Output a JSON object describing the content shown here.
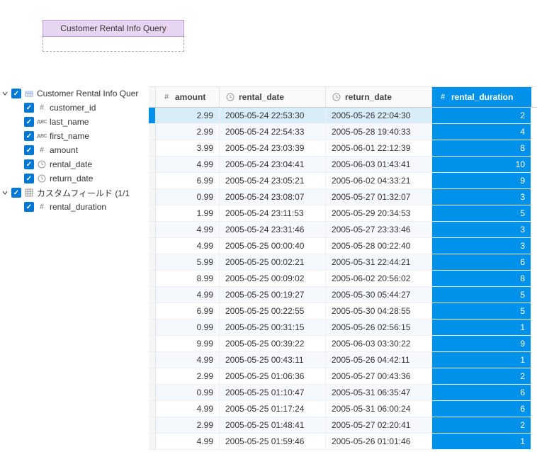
{
  "node": {
    "title": "Customer Rental Info Query"
  },
  "tree": {
    "root": {
      "label": "Customer Rental Info Quer"
    },
    "fields": [
      {
        "type": "num",
        "label": "customer_id"
      },
      {
        "type": "text",
        "label": "last_name"
      },
      {
        "type": "text",
        "label": "first_name"
      },
      {
        "type": "num",
        "label": "amount"
      },
      {
        "type": "date",
        "label": "rental_date"
      },
      {
        "type": "date",
        "label": "return_date"
      }
    ],
    "custom": {
      "label": "カスタムフィールド (1/1"
    },
    "custom_fields": [
      {
        "type": "num",
        "label": "rental_duration"
      }
    ]
  },
  "columns": {
    "amount": "amount",
    "rental_date": "rental_date",
    "return_date": "return_date",
    "rental_duration": "rental_duration"
  },
  "rows": [
    {
      "amount": "2.99",
      "rental_date": "2005-05-24 22:53:30",
      "return_date": "2005-05-26 22:04:30",
      "rental_duration": "2"
    },
    {
      "amount": "2.99",
      "rental_date": "2005-05-24 22:54:33",
      "return_date": "2005-05-28 19:40:33",
      "rental_duration": "4"
    },
    {
      "amount": "3.99",
      "rental_date": "2005-05-24 23:03:39",
      "return_date": "2005-06-01 22:12:39",
      "rental_duration": "8"
    },
    {
      "amount": "4.99",
      "rental_date": "2005-05-24 23:04:41",
      "return_date": "2005-06-03 01:43:41",
      "rental_duration": "10"
    },
    {
      "amount": "6.99",
      "rental_date": "2005-05-24 23:05:21",
      "return_date": "2005-06-02 04:33:21",
      "rental_duration": "9"
    },
    {
      "amount": "0.99",
      "rental_date": "2005-05-24 23:08:07",
      "return_date": "2005-05-27 01:32:07",
      "rental_duration": "3"
    },
    {
      "amount": "1.99",
      "rental_date": "2005-05-24 23:11:53",
      "return_date": "2005-05-29 20:34:53",
      "rental_duration": "5"
    },
    {
      "amount": "4.99",
      "rental_date": "2005-05-24 23:31:46",
      "return_date": "2005-05-27 23:33:46",
      "rental_duration": "3"
    },
    {
      "amount": "4.99",
      "rental_date": "2005-05-25 00:00:40",
      "return_date": "2005-05-28 00:22:40",
      "rental_duration": "3"
    },
    {
      "amount": "5.99",
      "rental_date": "2005-05-25 00:02:21",
      "return_date": "2005-05-31 22:44:21",
      "rental_duration": "6"
    },
    {
      "amount": "8.99",
      "rental_date": "2005-05-25 00:09:02",
      "return_date": "2005-06-02 20:56:02",
      "rental_duration": "8"
    },
    {
      "amount": "4.99",
      "rental_date": "2005-05-25 00:19:27",
      "return_date": "2005-05-30 05:44:27",
      "rental_duration": "5"
    },
    {
      "amount": "6.99",
      "rental_date": "2005-05-25 00:22:55",
      "return_date": "2005-05-30 04:28:55",
      "rental_duration": "5"
    },
    {
      "amount": "0.99",
      "rental_date": "2005-05-25 00:31:15",
      "return_date": "2005-05-26 02:56:15",
      "rental_duration": "1"
    },
    {
      "amount": "9.99",
      "rental_date": "2005-05-25 00:39:22",
      "return_date": "2005-06-03 03:30:22",
      "rental_duration": "9"
    },
    {
      "amount": "4.99",
      "rental_date": "2005-05-25 00:43:11",
      "return_date": "2005-05-26 04:42:11",
      "rental_duration": "1"
    },
    {
      "amount": "2.99",
      "rental_date": "2005-05-25 01:06:36",
      "return_date": "2005-05-27 00:43:36",
      "rental_duration": "2"
    },
    {
      "amount": "0.99",
      "rental_date": "2005-05-25 01:10:47",
      "return_date": "2005-05-31 06:35:47",
      "rental_duration": "6"
    },
    {
      "amount": "4.99",
      "rental_date": "2005-05-25 01:17:24",
      "return_date": "2005-05-31 06:00:24",
      "rental_duration": "6"
    },
    {
      "amount": "2.99",
      "rental_date": "2005-05-25 01:48:41",
      "return_date": "2005-05-27 02:20:41",
      "rental_duration": "2"
    },
    {
      "amount": "4.99",
      "rental_date": "2005-05-25 01:59:46",
      "return_date": "2005-05-26 01:01:46",
      "rental_duration": "1"
    }
  ],
  "icons": {
    "num": "#",
    "text": "ABC",
    "date_glyph": "clock",
    "table_glyph": "grid",
    "check": "✓",
    "chevron_down": "⌄"
  }
}
